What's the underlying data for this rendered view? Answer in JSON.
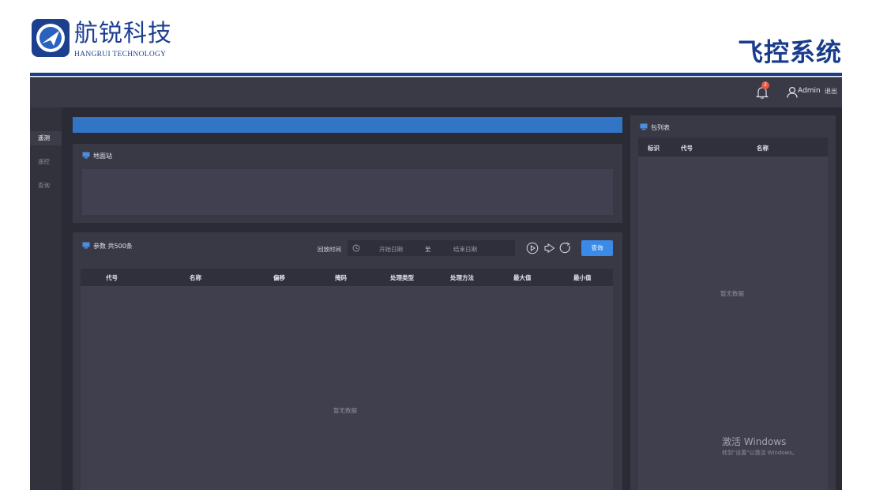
{
  "header": {
    "brand_name": "航锐科技",
    "brand_sub": "HANGRUI TECHNOLOGY",
    "slide_title": "飞控系统"
  },
  "topbar": {
    "notification_count": "2",
    "user_name": "Admin",
    "logout_label": "退出"
  },
  "sidebar": {
    "items": [
      {
        "label": "遥测",
        "active": true
      },
      {
        "label": "遥控",
        "active": false
      },
      {
        "label": "查询",
        "active": false
      }
    ]
  },
  "ground_station": {
    "title": "地面站"
  },
  "params": {
    "title": "参数  共500条",
    "time_label": "回放时间",
    "start_placeholder": "开始日期",
    "separator": "至",
    "end_placeholder": "结束日期",
    "query_label": "查询",
    "columns": [
      "代号",
      "名称",
      "偏移",
      "掩码",
      "处理类型",
      "处理方法",
      "最大值",
      "最小值"
    ],
    "empty_text": "暂无数据"
  },
  "packets": {
    "title": "包列表",
    "columns": [
      "标识",
      "代号",
      "名称"
    ],
    "empty_text": "暂无数据"
  },
  "watermark": {
    "line1": "激活 Windows",
    "line2": "转到\"设置\"以激活 Windows。"
  },
  "colors": {
    "brand": "#1c3f8f",
    "accent": "#3275c6",
    "button": "#3b8ae8",
    "badge": "#e65a48"
  }
}
